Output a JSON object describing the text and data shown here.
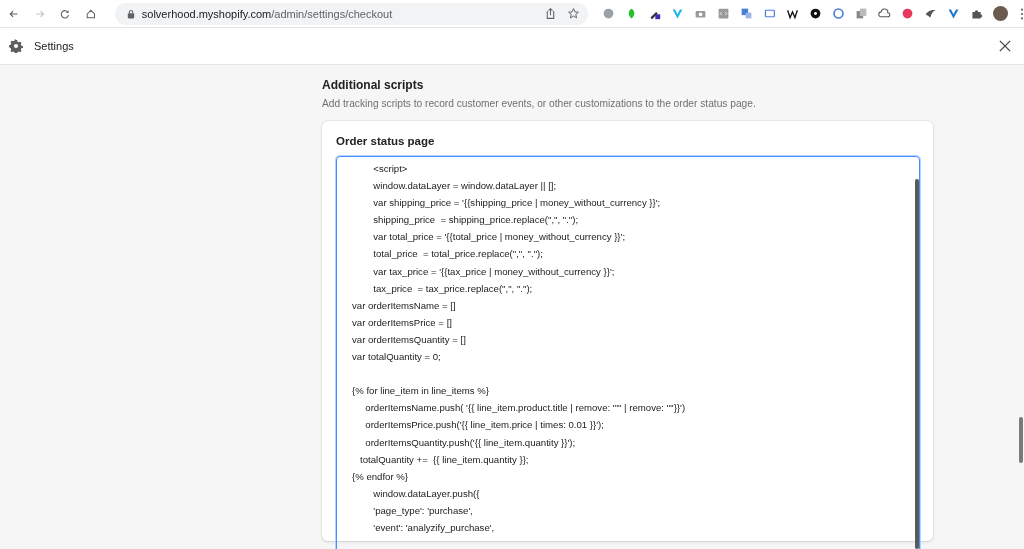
{
  "browser": {
    "url_host": "solverhood.myshopify.com",
    "url_path": "/admin/settings/checkout"
  },
  "header": {
    "title": "Settings"
  },
  "section": {
    "title": "Additional scripts",
    "description": "Add tracking scripts to record customer events, or other customizations to the order status page."
  },
  "card": {
    "title": "Order status page",
    "code": "        <script>\n        window.dataLayer = window.dataLayer || [];\n        var shipping_price = '{{shipping_price | money_without_currency }}';\n        shipping_price  = shipping_price.replace(\",\", \".\");\n        var total_price = '{{total_price | money_without_currency }}';\n        total_price  = total_price.replace(\",\", \".\");\n        var tax_price = '{{tax_price | money_without_currency }}';\n        tax_price  = tax_price.replace(\",\", \".\");\nvar orderItemsName = []\nvar orderItemsPrice = []\nvar orderItemsQuantity = []\nvar totalQuantity = 0;\n\n{% for line_item in line_items %}\n     orderItemsName.push( '{{ line_item.product.title | remove: \"'\" | remove: '\"'}}')\n     orderItemsPrice.push('{{ line_item.price | times: 0.01 }}');\n     orderItemsQuantity.push('{{ line_item.quantity }}');\n   totalQuantity +=  {{ line_item.quantity }};\n{% endfor %}\n        window.dataLayer.push({\n        'page_type': 'purchase',\n        'event': 'analyzify_purchase',"
  }
}
